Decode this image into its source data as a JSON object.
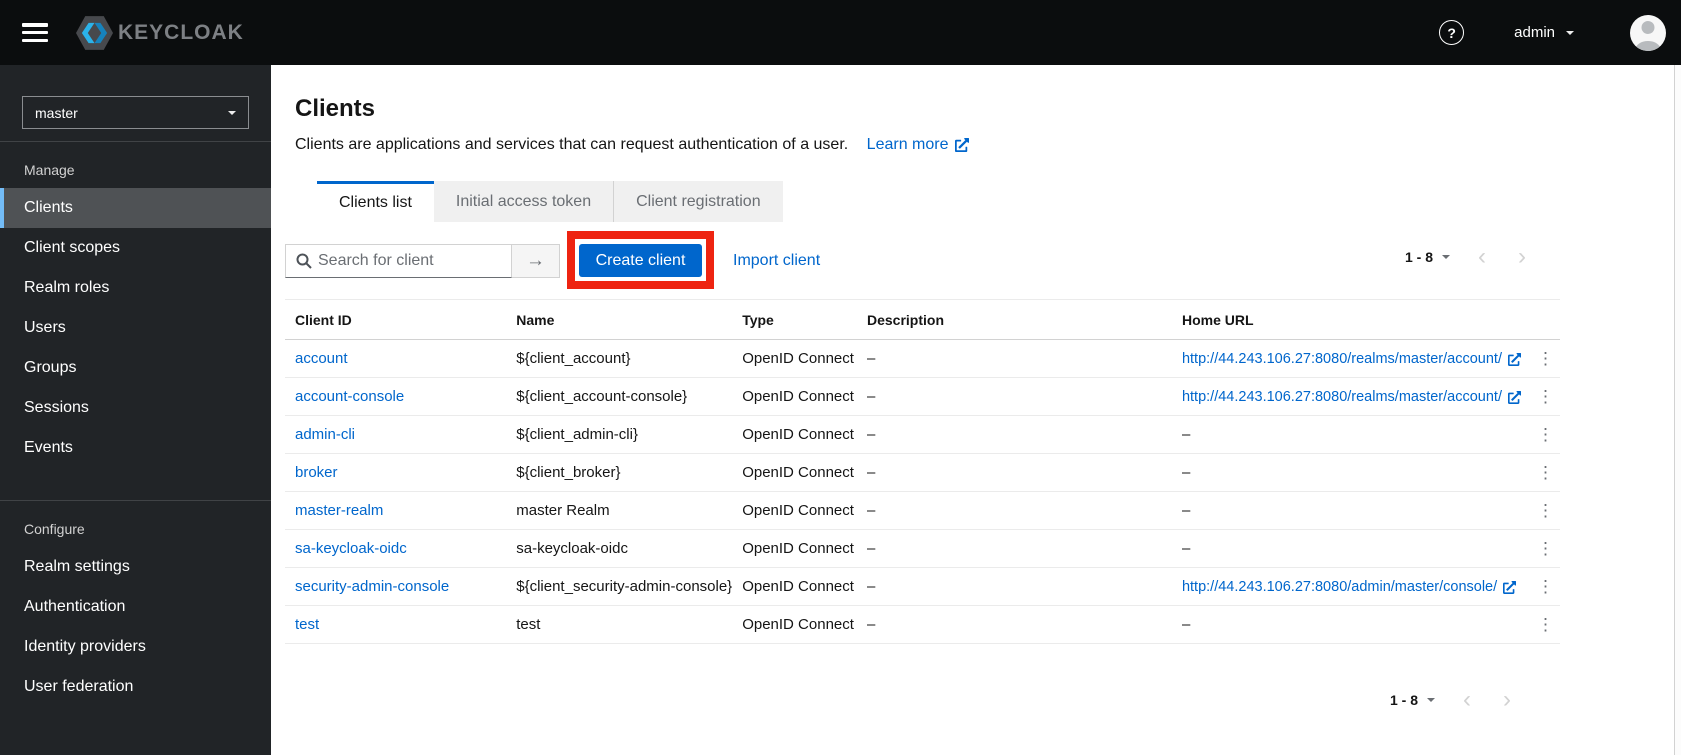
{
  "topbar": {
    "brand": "KEYCLOAK",
    "help_glyph": "?",
    "username": "admin"
  },
  "icons": {
    "chevron_left": "‹",
    "chevron_right": "›",
    "kebab": "⋮",
    "arrow_right": "→"
  },
  "sidebar": {
    "realm": "master",
    "groups": [
      {
        "label": "Manage",
        "items": [
          {
            "label": "Clients",
            "active": true
          },
          {
            "label": "Client scopes"
          },
          {
            "label": "Realm roles"
          },
          {
            "label": "Users"
          },
          {
            "label": "Groups"
          },
          {
            "label": "Sessions"
          },
          {
            "label": "Events"
          }
        ]
      },
      {
        "label": "Configure",
        "items": [
          {
            "label": "Realm settings"
          },
          {
            "label": "Authentication"
          },
          {
            "label": "Identity providers"
          },
          {
            "label": "User federation"
          }
        ]
      }
    ]
  },
  "main": {
    "title": "Clients",
    "subtitle": "Clients are applications and services that can request authentication of a user.",
    "learn_more_label": "Learn more",
    "tabs": [
      {
        "label": "Clients list",
        "active": true
      },
      {
        "label": "Initial access token"
      },
      {
        "label": "Client registration"
      }
    ],
    "toolbar": {
      "search_placeholder": "Search for client",
      "create_button_label": "Create client",
      "import_link_label": "Import client",
      "pagination_range": "1 - 8"
    },
    "table": {
      "columns": [
        "Client ID",
        "Name",
        "Type",
        "Description",
        "Home URL"
      ],
      "rows": [
        {
          "client_id": "account",
          "name": "${client_account}",
          "type": "OpenID Connect",
          "description": "–",
          "home_url": "http://44.243.106.27:8080/realms/master/account/"
        },
        {
          "client_id": "account-console",
          "name": "${client_account-console}",
          "type": "OpenID Connect",
          "description": "–",
          "home_url": "http://44.243.106.27:8080/realms/master/account/"
        },
        {
          "client_id": "admin-cli",
          "name": "${client_admin-cli}",
          "type": "OpenID Connect",
          "description": "–",
          "home_url": "–"
        },
        {
          "client_id": "broker",
          "name": "${client_broker}",
          "type": "OpenID Connect",
          "description": "–",
          "home_url": "–"
        },
        {
          "client_id": "master-realm",
          "name": "master Realm",
          "type": "OpenID Connect",
          "description": "–",
          "home_url": "–"
        },
        {
          "client_id": "sa-keycloak-oidc",
          "name": "sa-keycloak-oidc",
          "type": "OpenID Connect",
          "description": "–",
          "home_url": "–"
        },
        {
          "client_id": "security-admin-console",
          "name": "${client_security-admin-console}",
          "type": "OpenID Connect",
          "description": "–",
          "home_url": "http://44.243.106.27:8080/admin/master/console/"
        },
        {
          "client_id": "test",
          "name": "test",
          "type": "OpenID Connect",
          "description": "–",
          "home_url": "–"
        }
      ]
    },
    "pagination_bottom_range": "1 - 8"
  },
  "colors": {
    "accent_blue": "#0066cc",
    "link_blue": "#0066cc",
    "annotation_red": "#ee2411",
    "sidebar_bg": "#212427",
    "topbar_bg": "#0b0d0e",
    "active_nav_bg": "#4f5255",
    "active_nav_border": "#73bcf7"
  },
  "annotation": {
    "type": "highlight-rectangle",
    "color": "#ee2411",
    "target": "create-client-button"
  }
}
